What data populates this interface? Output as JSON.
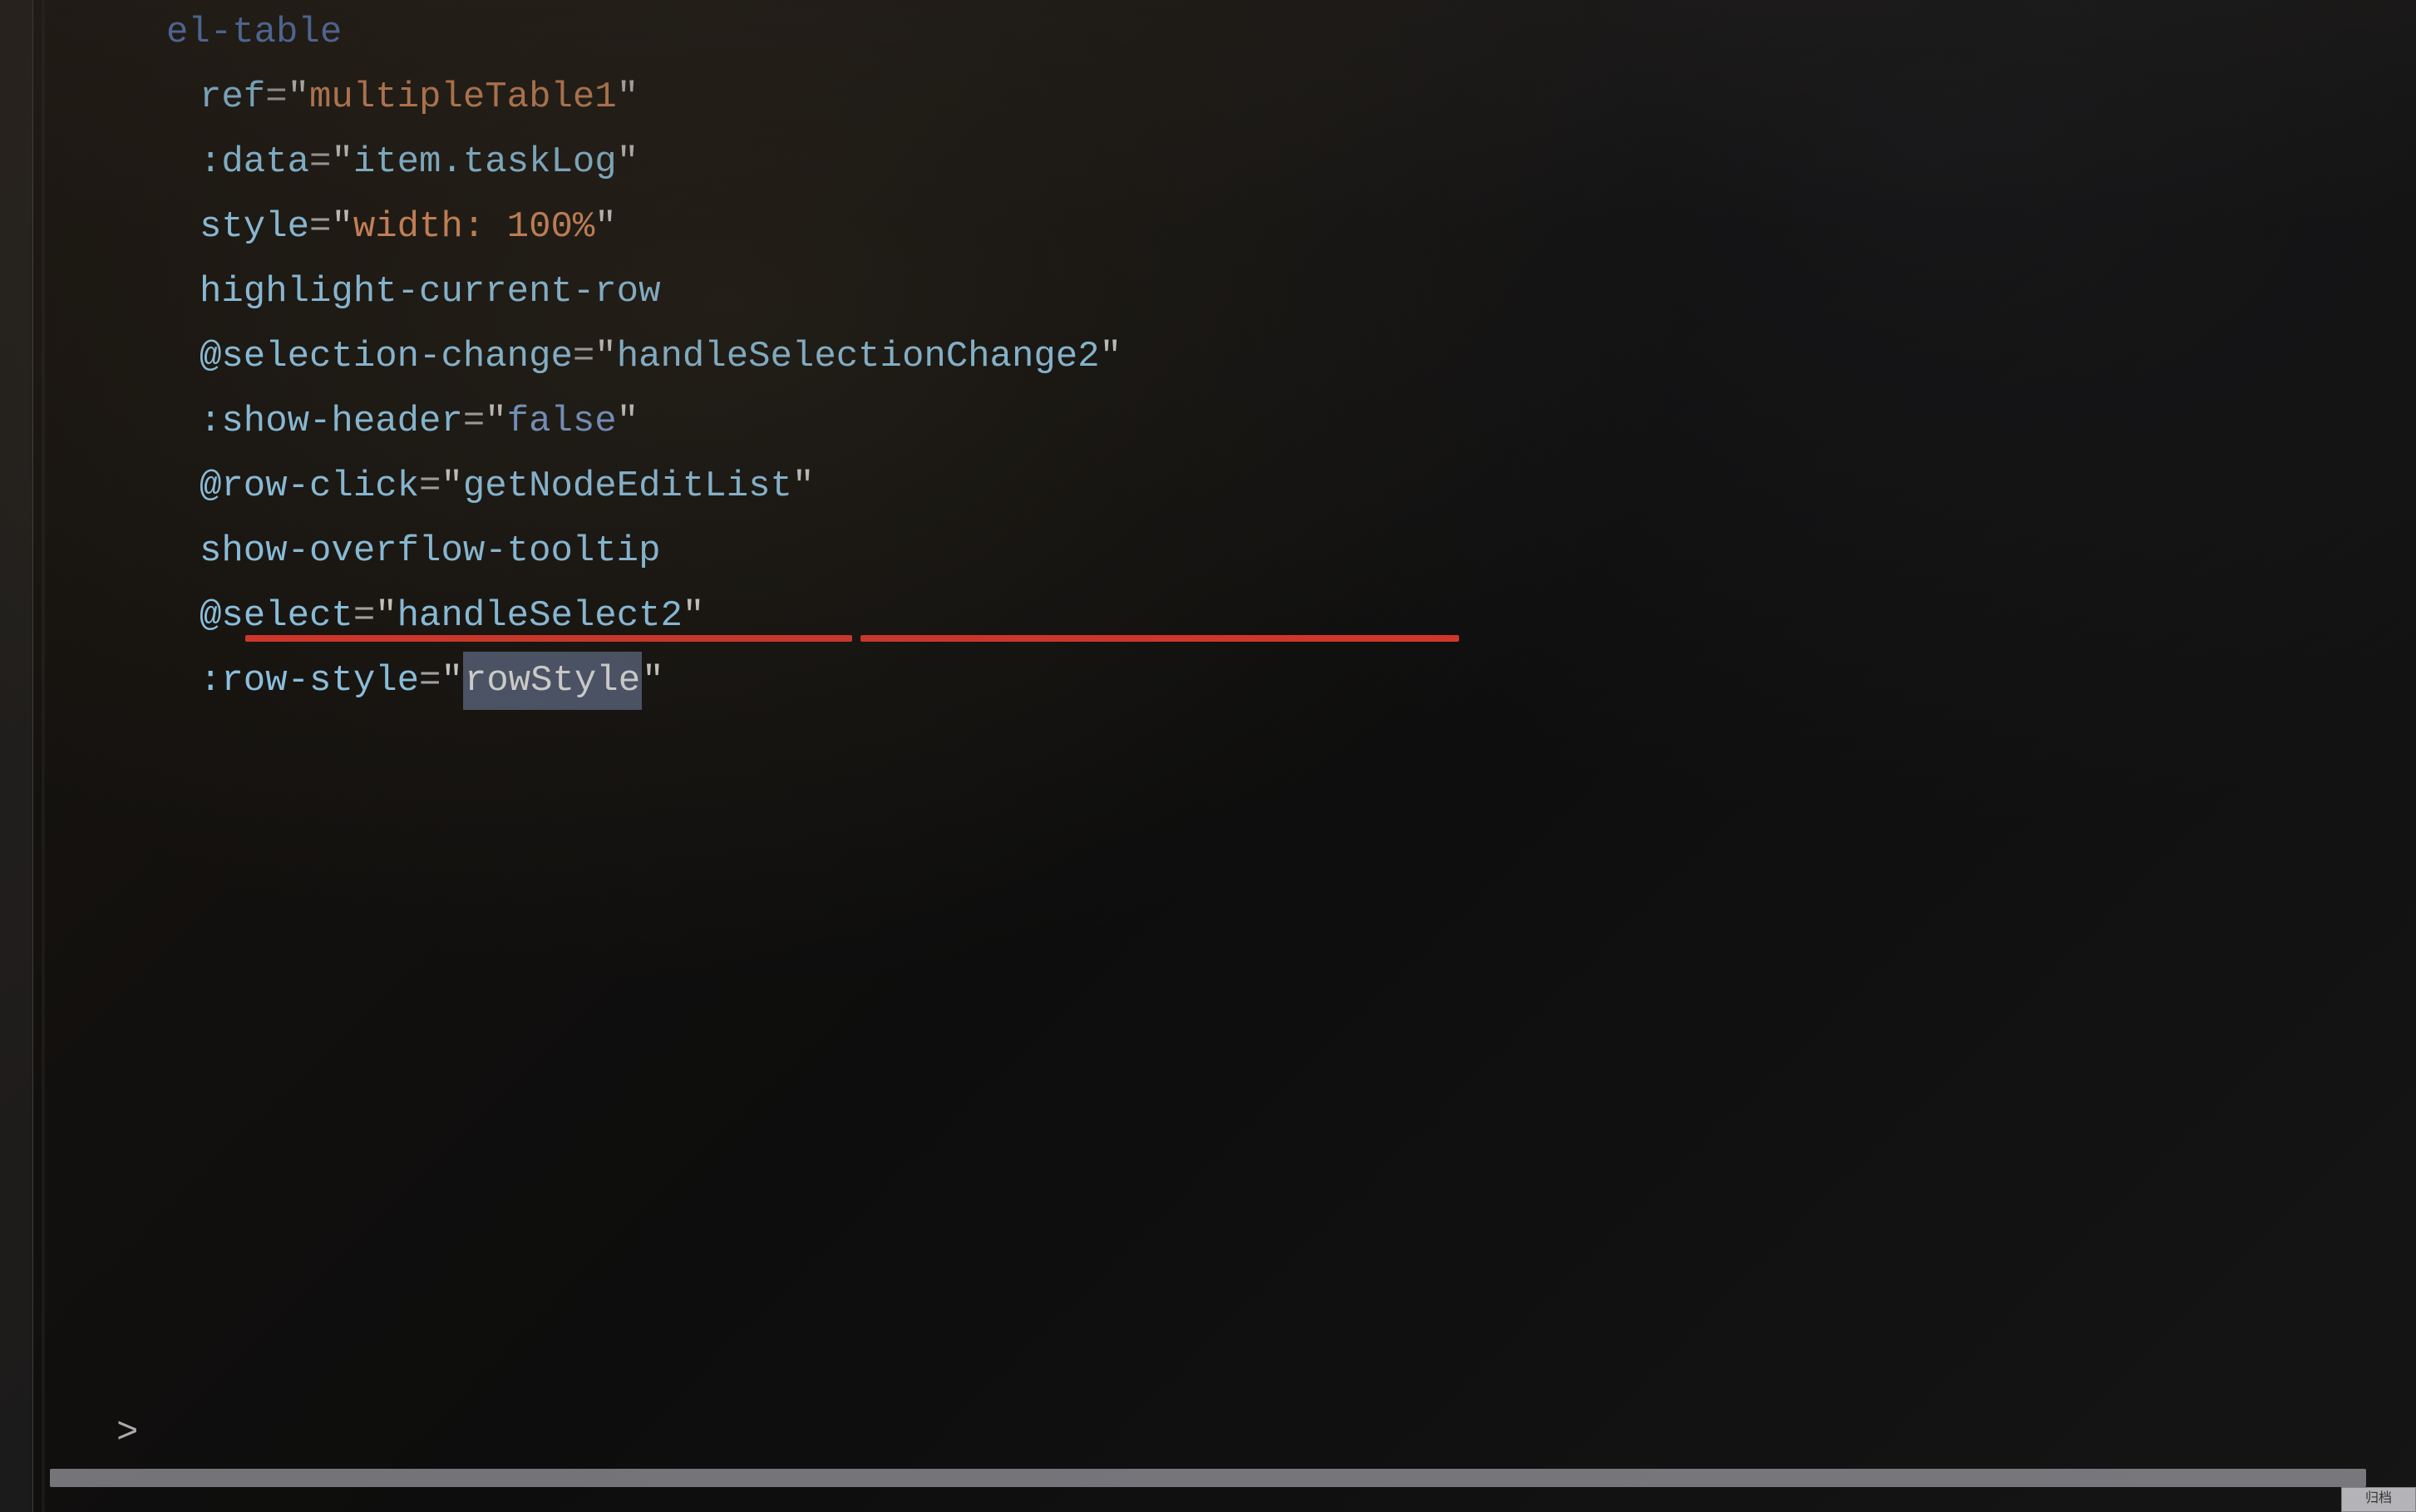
{
  "code": {
    "tag": "el-table",
    "attrs": [
      {
        "name": "ref",
        "eq": true,
        "value": "multipleTable1",
        "valueColor": "orange"
      },
      {
        "name": ":data",
        "eq": true,
        "value": "item.taskLog",
        "valueColor": "blue"
      },
      {
        "name": "style",
        "eq": true,
        "value": "width: 100%",
        "valueColor": "orange"
      },
      {
        "name": "highlight-current-row",
        "eq": false
      },
      {
        "name": "@selection-change",
        "eq": true,
        "value": "handleSelectionChange2",
        "valueColor": "blue"
      },
      {
        "name": ":show-header",
        "eq": true,
        "value": "false",
        "valueColor": "keyword"
      },
      {
        "name": "@row-click",
        "eq": true,
        "value": "getNodeEditList",
        "valueColor": "blue"
      },
      {
        "name": "show-overflow-tooltip",
        "eq": false
      },
      {
        "name": "@select",
        "eq": true,
        "value": "handleSelect2",
        "valueColor": "blue"
      },
      {
        "name": ":row-style",
        "eq": true,
        "value": "rowStyle",
        "valueColor": "blue",
        "selected": true
      }
    ]
  },
  "selection_text": "rowStyle",
  "status_hint": "归档",
  "error_underline_target": ":row-style=\"rowStyle\""
}
